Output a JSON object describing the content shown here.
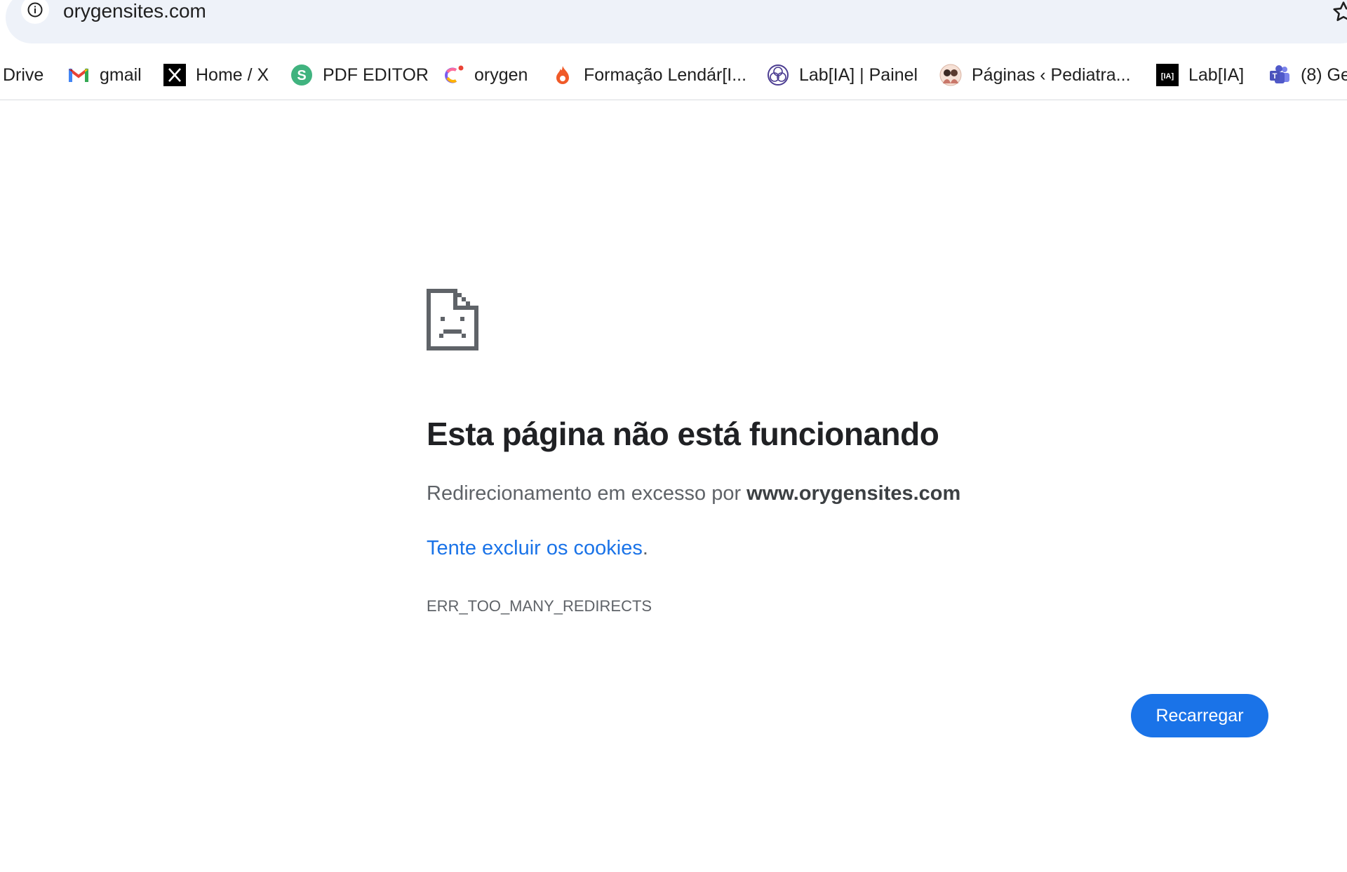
{
  "browser": {
    "url": "orygensites.com",
    "bookmarks": [
      {
        "label": "Drive",
        "icon": "drive-icon"
      },
      {
        "label": "gmail",
        "icon": "gmail-icon"
      },
      {
        "label": "Home / X",
        "icon": "x-logo-icon"
      },
      {
        "label": "PDF EDITOR",
        "icon": "pdf-editor-icon"
      },
      {
        "label": "orygen",
        "icon": "orygen-icon"
      },
      {
        "label": "Formação Lendár[I...",
        "icon": "flame-icon"
      },
      {
        "label": "Lab[IA] | Painel",
        "icon": "lab-ia-painel-icon"
      },
      {
        "label": "Páginas ‹ Pediatra...",
        "icon": "avatar-icon"
      },
      {
        "label": "Lab[IA]",
        "icon": "lab-ia-icon"
      },
      {
        "label": "(8) Ge",
        "icon": "teams-icon"
      }
    ]
  },
  "error": {
    "title": "Esta página não está funcionando",
    "description_prefix": "Redirecionamento em excesso por ",
    "description_host": "www.orygensites.com",
    "suggestion_link": "Tente excluir os cookies",
    "suggestion_suffix": ".",
    "code": "ERR_TOO_MANY_REDIRECTS",
    "reload_label": "Recarregar"
  },
  "colors": {
    "accent": "#1a73e8",
    "omnibox_bg": "#eef2f9",
    "text_secondary": "#5f6368"
  }
}
